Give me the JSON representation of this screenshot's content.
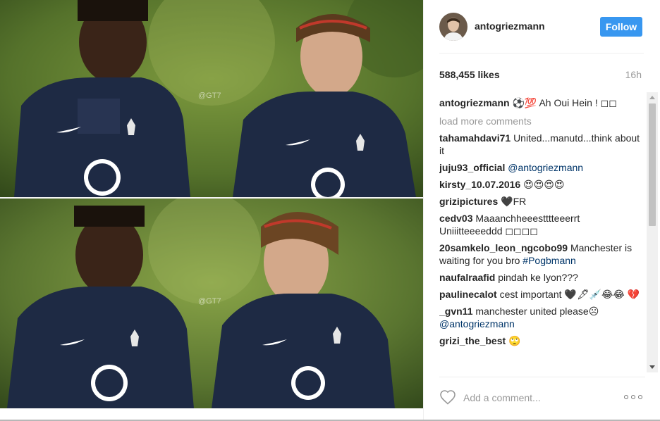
{
  "post": {
    "username": "antogriezmann",
    "follow_label": "Follow",
    "likes": "588,455 likes",
    "time": "16h",
    "watermark": "@GT7",
    "caption": {
      "user": "antogriezmann",
      "text": "⚽💯 Ah Oui Hein ! ◻◻"
    },
    "load_more": "load more comments",
    "comments": [
      {
        "user": "tahamahdavi71",
        "text": "United...manutd...think about it"
      },
      {
        "user": "juju93_official",
        "text": "",
        "mention": "@antogriezmann"
      },
      {
        "user": "kirsty_10.07.2016",
        "text": "😍😍😍😍"
      },
      {
        "user": "grizipictures",
        "text": "🖤FR"
      },
      {
        "user": "cedv03",
        "text": "Maaanchheeestttteeerrt Uniiitteeeeddd ◻◻◻◻"
      },
      {
        "user": "20samkelo_leon_ngcobo99",
        "text": "Manchester is waiting for you bro",
        "tag": "#Pogbmann"
      },
      {
        "user": "naufalraafid",
        "text": "pindah ke lyon???"
      },
      {
        "user": "paulinecalot",
        "text": "cest important 🖤🖋💉😂😂 💔"
      },
      {
        "user": "_gvn11",
        "text": "manchester united please☹",
        "mention": "@antogriezmann"
      },
      {
        "user": "grizi_the_best",
        "text": "🙄"
      }
    ],
    "comment_placeholder": "Add a comment...",
    "icons": {
      "heart": "heart-outline-icon",
      "more": "more-options-icon",
      "avatar": "profile-avatar"
    },
    "colors": {
      "follow_button": "#3897f0",
      "link": "#003569",
      "muted": "#999999"
    }
  }
}
